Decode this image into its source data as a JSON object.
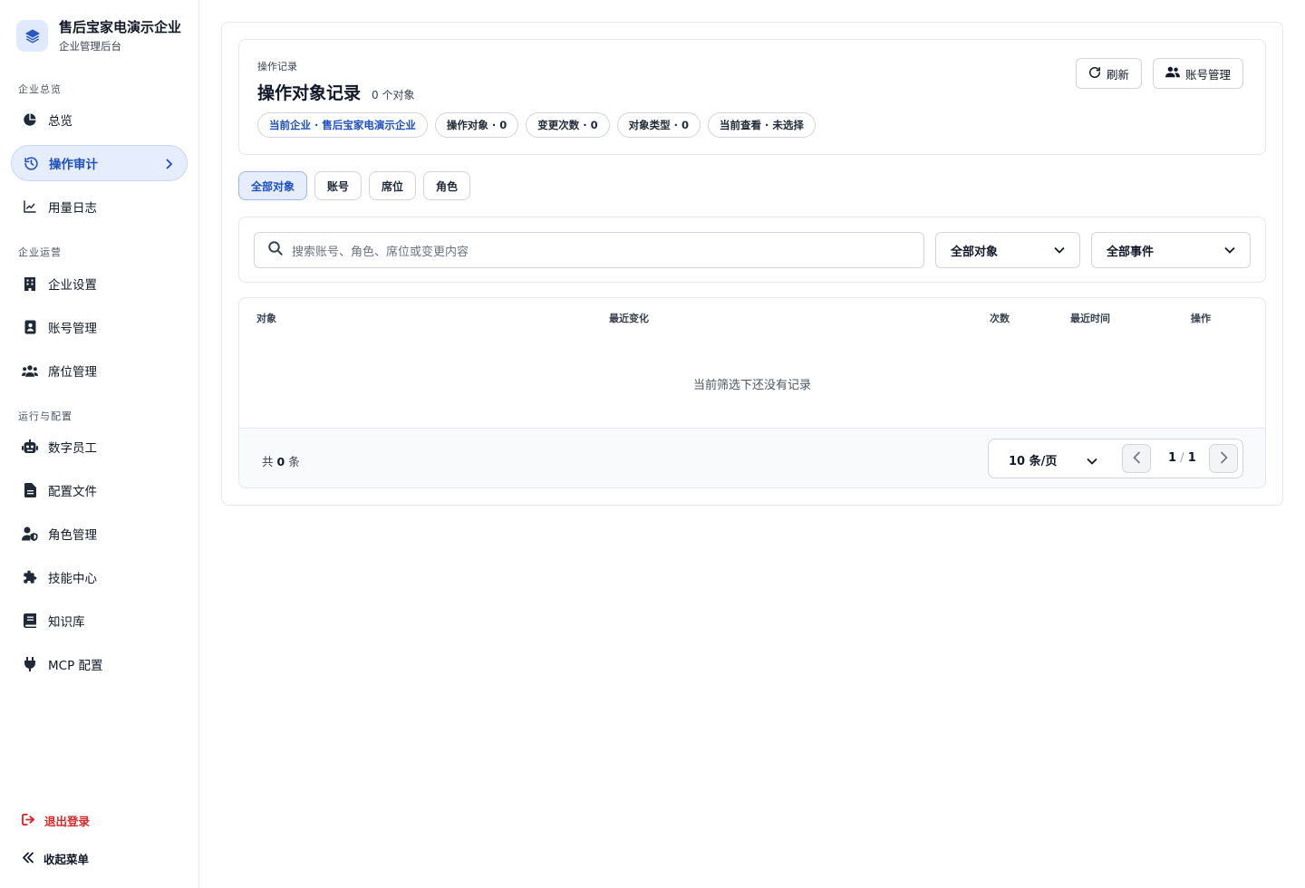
{
  "brand": {
    "name": "售后宝家电演示企业",
    "subtitle": "企业管理后台"
  },
  "sidebar": {
    "sections": [
      {
        "label": "企业总览"
      },
      {
        "label": "企业运营"
      },
      {
        "label": "运行与配置"
      }
    ],
    "items": [
      {
        "label": "总览",
        "icon": "pie-chart-icon"
      },
      {
        "label": "操作审计",
        "icon": "history-icon",
        "active": true
      },
      {
        "label": "用量日志",
        "icon": "line-chart-icon"
      },
      {
        "label": "企业设置",
        "icon": "building-icon"
      },
      {
        "label": "账号管理",
        "icon": "id-badge-icon"
      },
      {
        "label": "席位管理",
        "icon": "users-icon"
      },
      {
        "label": "数字员工",
        "icon": "robot-icon"
      },
      {
        "label": "配置文件",
        "icon": "file-icon"
      },
      {
        "label": "角色管理",
        "icon": "user-shield-icon"
      },
      {
        "label": "技能中心",
        "icon": "puzzle-icon"
      },
      {
        "label": "知识库",
        "icon": "book-icon"
      },
      {
        "label": "MCP 配置",
        "icon": "plug-icon"
      }
    ],
    "logout_label": "退出登录",
    "collapse_label": "收起菜单"
  },
  "header": {
    "breadcrumb": "操作记录",
    "title": "操作对象记录",
    "count_text": "0 个对象",
    "chips": [
      "当前企业 · 售后宝家电演示企业",
      "操作对象 · 0",
      "变更次数 · 0",
      "对象类型 · 0",
      "当前查看 · 未选择"
    ],
    "refresh_label": "刷新",
    "account_label": "账号管理"
  },
  "tabs": [
    {
      "label": "全部对象",
      "active": true
    },
    {
      "label": "账号"
    },
    {
      "label": "席位"
    },
    {
      "label": "角色"
    }
  ],
  "filters": {
    "search_placeholder": "搜索账号、角色、席位或变更内容",
    "object_select": "全部对象",
    "event_select": "全部事件"
  },
  "table": {
    "columns": [
      "对象",
      "最近变化",
      "次数",
      "最近时间",
      "操作"
    ],
    "empty_text": "当前筛选下还没有记录",
    "total_prefix": "共",
    "total_count": "0",
    "total_suffix": "条",
    "page_size": "10 条/页",
    "current_page": "1",
    "page_separator": "/",
    "total_pages": "1"
  },
  "colors": {
    "accent": "#1d4fc2",
    "accent_bg": "#e6eefe",
    "danger": "#dc2626"
  }
}
